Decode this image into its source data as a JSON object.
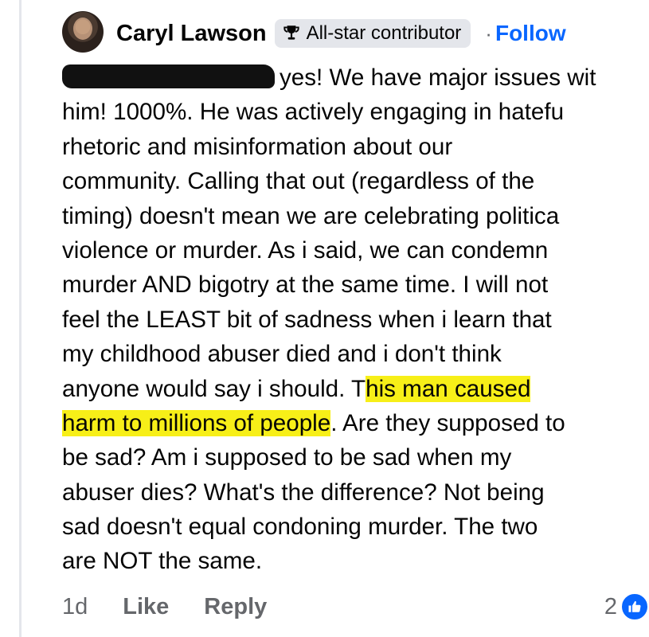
{
  "comment": {
    "author": "Caryl Lawson",
    "badge": "All-star contributor",
    "follow_separator": "·",
    "follow_label": "Follow",
    "lines": [
      "yes! We have major issues wit",
      "him!  1000%. He was actively engaging in hatefu",
      "rhetoric and misinformation about our",
      "community. Calling that out (regardless of the",
      "timing)  doesn't mean we are celebrating politica",
      "violence or murder. As i said, we can condemn",
      "murder AND bigotry at the same time. I will not",
      "feel the LEAST bit of sadness when i learn that",
      "my childhood abuser died and i don't think"
    ],
    "line10_pre": "anyone would say i should. T",
    "line10_hl": "his man caused",
    "line11_hl": "harm to millions of people",
    "line11_post": ". Are they supposed to",
    "tail_lines": [
      "be sad? Am i supposed to be sad when my",
      "abuser dies? What's the difference? Not being",
      "sad doesn't equal condoning murder. The two",
      "are NOT the same."
    ],
    "highlight_color": "#f7ef18"
  },
  "footer": {
    "time": "1d",
    "like_label": "Like",
    "reply_label": "Reply",
    "reaction_count": "2",
    "reaction_icon": "thumbs-up-icon"
  },
  "colors": {
    "link": "#0866ff",
    "meta": "#65676b",
    "badge_bg": "#e4e6eb"
  }
}
